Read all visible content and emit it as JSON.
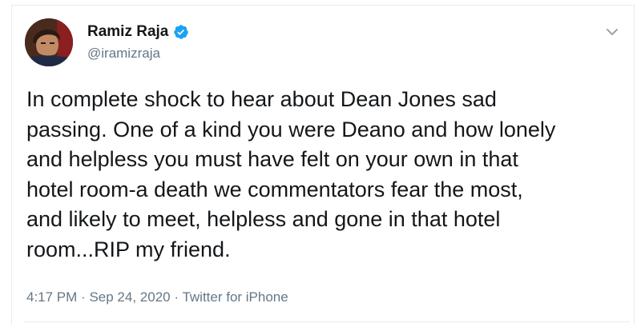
{
  "author": {
    "display_name": "Ramiz Raja",
    "handle": "@iramizraja",
    "verified": true,
    "avatar_icon": "profile-photo",
    "verified_icon": "verified-badge-icon",
    "verified_color": "#1da1f2"
  },
  "menu": {
    "icon": "chevron-down-icon"
  },
  "tweet": {
    "text": "In complete shock to hear about Dean Jones sad\npassing. One of a kind you were Deano and how lonely\nand helpless you must have felt on your own in that\nhotel room-a death we commentators fear the most,\nand likely to meet, helpless and gone in that hotel\nroom...RIP my friend."
  },
  "meta": {
    "time": "4:17 PM",
    "separator": "·",
    "date": "Sep 24, 2020",
    "source": "Twitter for iPhone"
  },
  "colors": {
    "text_primary": "#14171a",
    "text_secondary": "#657786",
    "border": "#e6ecf0"
  }
}
